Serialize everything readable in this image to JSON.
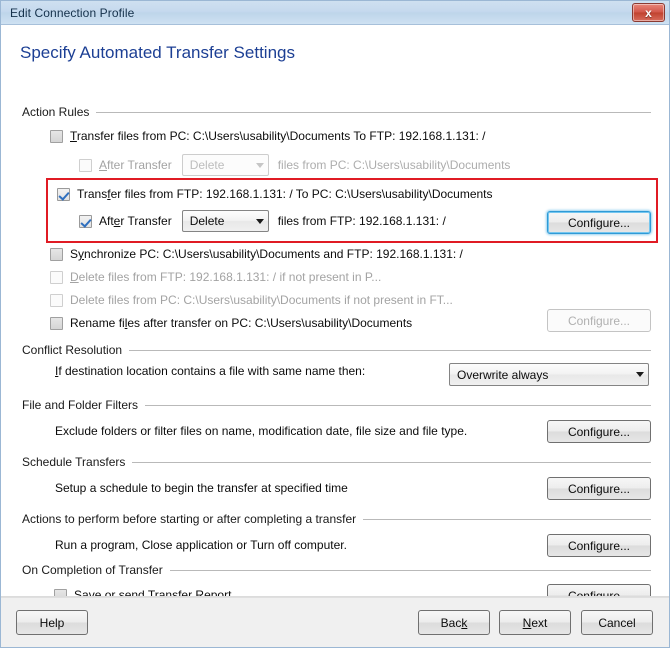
{
  "window": {
    "title": "Edit Connection Profile",
    "close_label": "x"
  },
  "page_title": "Specify Automated Transfer Settings",
  "groups": {
    "action_rules": "Action Rules",
    "conflict_resolution": "Conflict Resolution",
    "file_folder_filters": "File and Folder Filters",
    "schedule_transfers": "Schedule Transfers",
    "actions_before_after": "Actions to perform before starting or after completing a transfer",
    "on_completion": "On Completion of Transfer"
  },
  "action_rules": [
    {
      "id": "pc-to-ftp",
      "checked": false,
      "enabled": true,
      "label_pre": "",
      "accel": "T",
      "label_post": "ransfer files from PC: C:\\Users\\usability\\Documents  To  FTP: 192.168.1.131: /"
    },
    {
      "id": "ftp-to-pc",
      "checked": true,
      "enabled": true,
      "label_pre": "Trans",
      "accel": "f",
      "label_post": "er files from FTP: 192.168.1.131: /  To  PC: C:\\Users\\usability\\Documents"
    },
    {
      "id": "synchronize",
      "checked": false,
      "enabled": true,
      "label_pre": "S",
      "accel": "y",
      "label_post": "nchronize PC: C:\\Users\\usability\\Documents and FTP: 192.168.1.131: /"
    },
    {
      "id": "delete-from-ftp",
      "checked": false,
      "enabled": false,
      "label_pre": "",
      "accel": "D",
      "label_post": "elete files from FTP: 192.168.1.131: / if not present in P..."
    },
    {
      "id": "delete-from-pc",
      "checked": false,
      "enabled": false,
      "label_pre": "Delete files from PC: C:\\Users\\usability\\Documents if not present in FT...",
      "accel": "",
      "label_post": ""
    },
    {
      "id": "rename-files",
      "checked": false,
      "enabled": true,
      "label_pre": "Rename fi",
      "accel": "l",
      "label_post": "es after transfer on PC: C:\\Users\\usability\\Documents"
    }
  ],
  "after_transfer": {
    "pc_to_ftp": {
      "checked": false,
      "enabled": false,
      "label_pre": "",
      "accel": "A",
      "label_post": "fter Transfer",
      "combo_value": "Delete",
      "suffix": "files from PC: C:\\Users\\usability\\Documents"
    },
    "ftp_to_pc": {
      "checked": true,
      "enabled": true,
      "label_pre": "Aft",
      "accel": "e",
      "label_post": "r Transfer",
      "combo_value": "Delete",
      "suffix": "files from FTP: 192.168.1.131: /"
    }
  },
  "conflict_resolution": {
    "label_pre": "",
    "accel": "I",
    "label_post": "f destination location contains a file with same name then:",
    "selected": "Overwrite always"
  },
  "file_folder_filters": {
    "description": "Exclude folders or filter files on name, modification date, file size and file type."
  },
  "schedule_transfers": {
    "description": "Setup a schedule to begin the transfer at specified time"
  },
  "actions_before_after": {
    "description": "Run a program, Close application or Turn off computer."
  },
  "on_completion": {
    "checked": false,
    "enabled": true,
    "label_pre": "Sa",
    "accel": "v",
    "label_post": "e or send Transfer Report"
  },
  "buttons": {
    "configure_pre": "Confi",
    "configure_accel": "g",
    "configure_post": "ure...",
    "configure_plain": "Configure...",
    "help": "Help",
    "back_pre": "Bac",
    "back_accel": "k",
    "back_post": "",
    "next_pre": "",
    "next_accel": "N",
    "next_post": "ext",
    "cancel": "Cancel"
  },
  "colors": {
    "accent_title": "#1c3f94",
    "highlight_annotation": "#e01b24",
    "focus_border": "#2f9ad6",
    "checkmark": "#2f6fbe"
  }
}
